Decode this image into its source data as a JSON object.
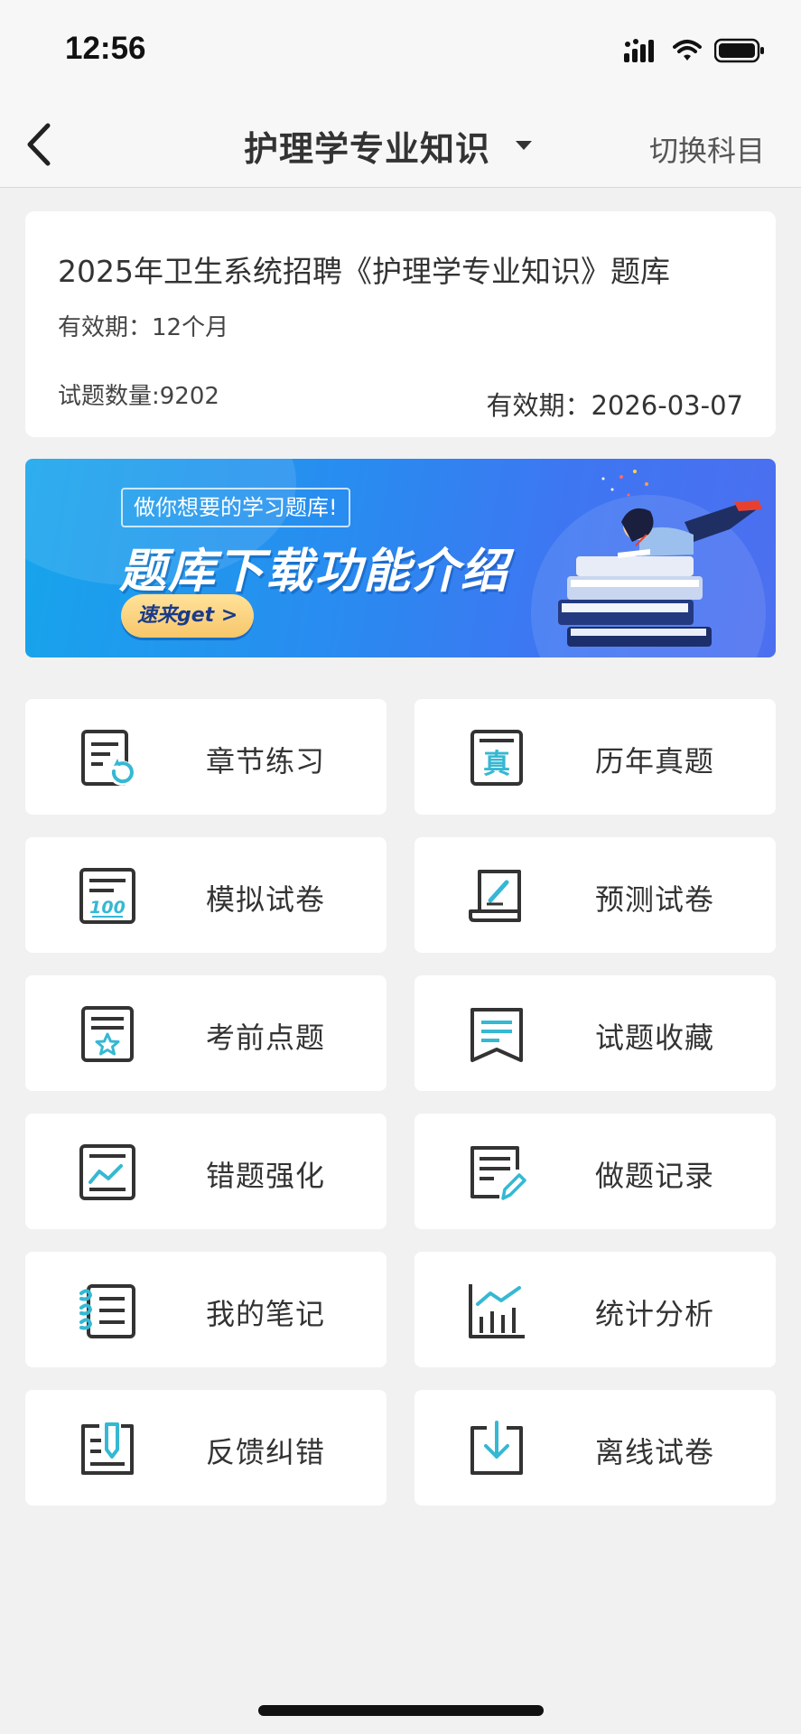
{
  "status_bar": {
    "time": "12:56"
  },
  "nav": {
    "title": "护理学专业知识",
    "switch_label": "切换科目"
  },
  "info_card": {
    "title": "2025年卫生系统招聘《护理学专业知识》题库",
    "validity": "有效期：12个月",
    "question_count": "试题数量:9202",
    "expiry": "有效期：2026-03-07"
  },
  "banner": {
    "tag": "做你想要的学习题库!",
    "title": "题库下载功能介绍",
    "button": "速来get >"
  },
  "menu": [
    {
      "label": "章节练习",
      "icon": "chapter-practice-icon"
    },
    {
      "label": "历年真题",
      "icon": "past-exams-icon"
    },
    {
      "label": "模拟试卷",
      "icon": "mock-paper-icon"
    },
    {
      "label": "预测试卷",
      "icon": "predict-paper-icon"
    },
    {
      "label": "考前点题",
      "icon": "key-points-icon"
    },
    {
      "label": "试题收藏",
      "icon": "bookmark-icon"
    },
    {
      "label": "错题强化",
      "icon": "wrong-questions-icon"
    },
    {
      "label": "做题记录",
      "icon": "practice-record-icon"
    },
    {
      "label": "我的笔记",
      "icon": "notes-icon"
    },
    {
      "label": "统计分析",
      "icon": "statistics-icon"
    },
    {
      "label": "反馈纠错",
      "icon": "feedback-icon"
    },
    {
      "label": "离线试卷",
      "icon": "offline-download-icon"
    }
  ],
  "colors": {
    "accent": "#35b8d3",
    "icon_dark": "#333333",
    "banner_blue": "#2a8af0"
  }
}
